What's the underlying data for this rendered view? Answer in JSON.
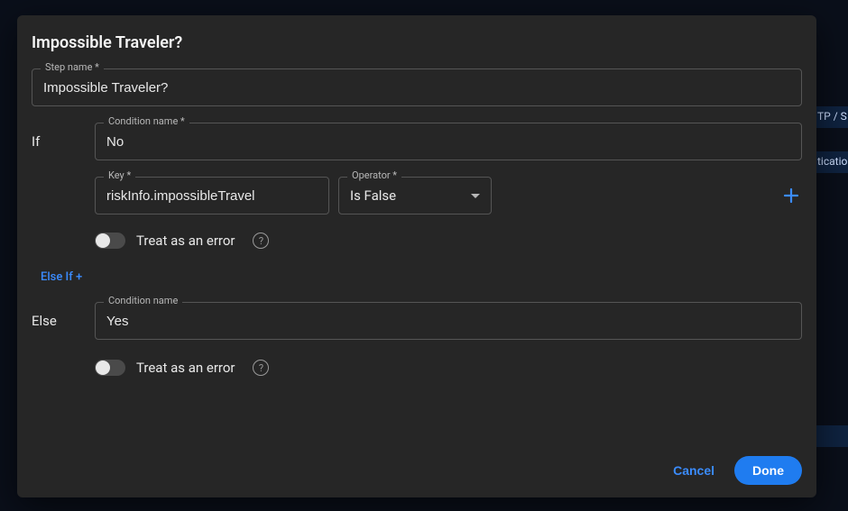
{
  "background": {
    "strip1": "TP / S",
    "strip2": "ticatio",
    "strip3": ""
  },
  "modal": {
    "title": "Impossible Traveler?",
    "stepName": {
      "label": "Step name *",
      "value": "Impossible Traveler?"
    },
    "ifBranch": {
      "label": "If",
      "conditionName": {
        "label": "Condition name *",
        "value": "No"
      },
      "key": {
        "label": "Key *",
        "value": "riskInfo.impossibleTravel"
      },
      "operator": {
        "label": "Operator *",
        "value": "Is False"
      },
      "treatAsError": {
        "label": "Treat as an error",
        "on": false
      }
    },
    "elseIf": {
      "label": "Else If +"
    },
    "elseBranch": {
      "label": "Else",
      "conditionName": {
        "label": "Condition name",
        "value": "Yes"
      },
      "treatAsError": {
        "label": "Treat as an error",
        "on": false
      }
    },
    "footer": {
      "cancel": "Cancel",
      "done": "Done"
    }
  }
}
